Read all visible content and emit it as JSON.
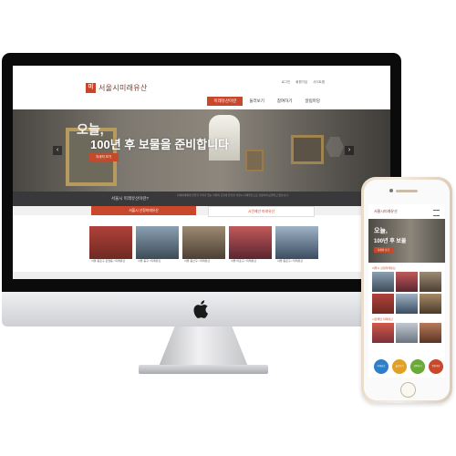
{
  "site": {
    "logo_mark": "미",
    "logo_text": "서울시미래유산",
    "util_links": [
      "로그인",
      "회원가입",
      "사이트맵"
    ],
    "gnb": [
      {
        "label": "미래유산이란",
        "active": true
      },
      {
        "label": "둘러보기",
        "active": false
      },
      {
        "label": "참여하기",
        "active": false
      },
      {
        "label": "알림마당",
        "active": false
      }
    ],
    "hero": {
      "title1": "오늘,",
      "title2": "100년 후 보물을 준비합니다",
      "button": "자세히 보기",
      "prev": "‹",
      "next": "›"
    },
    "info": {
      "lead": "서울시 미래유산이란?",
      "body": "미래세대에게 전달할 가치가 있는 서울의 근현대 유산을 서울시 미래유산으로 선정하여 보존하고 있습니다."
    },
    "tabs": {
      "left": "서울시 선정미래유산",
      "right": "시민제안 미래유산"
    },
    "cards": [
      {
        "caption": "서울 종로구 관철동 / 미래유산",
        "color": "#8b3a2e"
      },
      {
        "caption": "서울 중구 / 미래유산",
        "color": "#5a6b7a"
      },
      {
        "caption": "서울 용산구 / 미래유산",
        "color": "#6e5a48"
      },
      {
        "caption": "서울 마포구 / 미래유산",
        "color": "#7c2f3a"
      },
      {
        "caption": "서울 종로구 / 미래유산",
        "color": "#44576b"
      }
    ]
  },
  "mobile": {
    "logo": "서울시미래유산",
    "hero_title1": "오늘,",
    "hero_title2": "100년 후 보물",
    "hero_btn": "자세히 보기",
    "section1": "서울시 선정미래유산",
    "section2": "시민제안 미래유산",
    "circles": [
      {
        "label": "미래유산",
        "color": "#2e7fc8"
      },
      {
        "label": "둘러보기",
        "color": "#e2a126"
      },
      {
        "label": "참여하기",
        "color": "#6aaa3a"
      },
      {
        "label": "알림마당",
        "color": "#c9472b"
      }
    ]
  },
  "colors": {
    "accent": "#c9472b",
    "dark_strip": "#39393b"
  }
}
